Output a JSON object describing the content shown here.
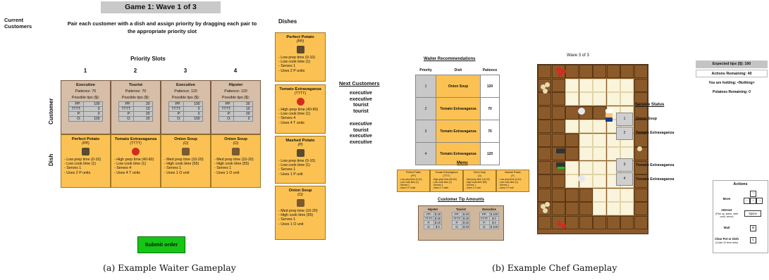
{
  "waiter": {
    "title": "Game 1:  Wave 1 of 3",
    "current_customers": "Current Customers",
    "instructions": "Pair each customer with a dish and assign priority by dragging each pair to the appropriate priority slot",
    "priority_slots_label": "Priority Slots",
    "row_labels": {
      "customer": "Customer",
      "dish": "Dish"
    },
    "slots": [
      {
        "num": "1",
        "customer": {
          "name": "Executive",
          "patience": "Patience: 70",
          "tips_label": "Possible tips ($):",
          "tips": [
            [
              "PP:",
              "100"
            ],
            [
              "TTTT:",
              "0"
            ],
            [
              "P:",
              "0"
            ],
            [
              "O:",
              "100"
            ]
          ]
        },
        "dish": {
          "name": "Perfect Potato",
          "code": "(PP)",
          "lines": [
            "-   Low prep time (0-10)",
            "-   Low cook time (1)",
            "-   Serves 1",
            "-   Uses 2 P units"
          ]
        }
      },
      {
        "num": "2",
        "customer": {
          "name": "Tourist",
          "patience": "Patience: 70",
          "tips_label": "Possible tips ($):",
          "tips": [
            [
              "PP:",
              "20"
            ],
            [
              "TTTT:",
              "10"
            ],
            [
              "P:",
              "20"
            ],
            [
              "O:",
              "20"
            ]
          ]
        },
        "dish": {
          "name": "Tomato Extravaganza",
          "code": "(TTTT)",
          "lines": [
            "-   High prep time (40-60)",
            "-   Low cook time (1)",
            "-   Serves 4",
            "-   Uses 4 T units"
          ]
        }
      },
      {
        "num": "3",
        "customer": {
          "name": "Executive",
          "patience": "Patience: 120",
          "tips_label": "Possible tips ($):",
          "tips": [
            [
              "PP:",
              "100"
            ],
            [
              "TTTT:",
              "0"
            ],
            [
              "P:",
              "0"
            ],
            [
              "O:",
              "100"
            ]
          ]
        },
        "dish": {
          "name": "Onion Soup",
          "code": "(O)",
          "lines": [
            "-   Med prep time (10-20)",
            "-   High cook time (55)",
            "-   Serves 1",
            "-   Uses 1 O unit"
          ]
        }
      },
      {
        "num": "4",
        "customer": {
          "name": "Hipster",
          "patience": "Patience: 120",
          "tips_label": "Possible tips ($):",
          "tips": [
            [
              "PP:",
              "20"
            ],
            [
              "TTTT:",
              "10"
            ],
            [
              "P:",
              "20"
            ],
            [
              "O:",
              "0"
            ]
          ]
        },
        "dish": {
          "name": "Onion Soup",
          "code": "(O)",
          "lines": [
            "-   Med prep time (10-20)",
            "-   High cook time (55)",
            "-   Serves 1",
            "-   Uses 1 O unit"
          ]
        }
      }
    ],
    "dishes_label": "Dishes",
    "side_dishes": [
      {
        "name": "Perfect Potato",
        "code": "(PP)",
        "lines": [
          "-   Low prep time (0-10)",
          "-   Low cook time (1)",
          "-   Serves 1",
          "-   Uses 2 P units"
        ]
      },
      {
        "name": "Tomato Extravaganza",
        "code": "(TTTT)",
        "lines": [
          "-   High prep time (40-60)",
          "-   Low cook time (1)",
          "-   Serves 4",
          "-   Uses 4 T units"
        ]
      },
      {
        "name": "Mashed Potato",
        "code": "(P)",
        "lines": [
          "-   Low prep time (0-10)",
          "-   Low cook time (1)",
          "-   Serves 1",
          "-   Uses 1 P unit"
        ]
      },
      {
        "name": "Onion Soup",
        "code": "(O)",
        "lines": [
          "-   Med prep time (10-20)",
          "-   High cook time (55)",
          "-   Serves 1",
          "-   Uses 1 O unit"
        ]
      }
    ],
    "next_customers_label": "Next Customers",
    "next_customers_group1": [
      "executive",
      "executive",
      "tourist",
      "tourist"
    ],
    "next_customers_group2": [
      "executive",
      "tourist",
      "executive",
      "executive"
    ],
    "submit_label": "Submit order",
    "caption": "(a) Example Waiter Gameplay"
  },
  "chef": {
    "waiter_rec_label": "Waiter Recommendations",
    "rec_headers": [
      "Priority",
      "Dish",
      "Patience"
    ],
    "recs": [
      [
        "1",
        "Onion Soup",
        "120"
      ],
      [
        "2",
        "Tomato Extravaganza",
        "70"
      ],
      [
        "3",
        "Tomato Extravaganza",
        "70"
      ],
      [
        "4",
        "Tomato Extravaganza",
        "120"
      ]
    ],
    "menu_label": "Menu",
    "menu": [
      {
        "name": "Perfect Potato",
        "code": "(PP)",
        "lines": [
          "- Low prep time (0-10)",
          "- Low cook time (1)",
          "- Serves 1",
          "- Uses 2 P units"
        ]
      },
      {
        "name": "Tomato Extravaganza",
        "code": "(TTTT)",
        "lines": [
          "- High prep time (40-60)",
          "- Low cook time (1)",
          "- Serves 4",
          "- Uses 4 T units"
        ]
      },
      {
        "name": "Onion Soup",
        "code": "(O)",
        "lines": [
          "- Med prep time (10-20)",
          "- High cook time (55)",
          "- Serves 1",
          "- Uses 1 O unit"
        ]
      },
      {
        "name": "Mashed Potato",
        "code": "(P)",
        "lines": [
          "- Low prep time (0-10)",
          "- Low cook time (1)",
          "- Serves 1",
          "- Uses 1 P unit"
        ]
      }
    ],
    "tip_amounts_label": "Customer Tip Amounts",
    "tip_amounts": [
      {
        "name": "Hipster",
        "rows": [
          [
            "PP:",
            "$ 20"
          ],
          [
            "TTTT:",
            "$ 30"
          ],
          [
            "P:",
            "$ 20"
          ],
          [
            "O:",
            "$ 0"
          ]
        ]
      },
      {
        "name": "Tourist",
        "rows": [
          [
            "PP:",
            "$ 20"
          ],
          [
            "TTTT:",
            "$ 30"
          ],
          [
            "P:",
            "$ 20"
          ],
          [
            "O:",
            "$ 20"
          ]
        ]
      },
      {
        "name": "Executive",
        "rows": [
          [
            "PP:",
            "$ 100"
          ],
          [
            "TTTT:",
            "$ 0"
          ],
          [
            "P:",
            "$ 0"
          ],
          [
            "O:",
            "$ 100"
          ]
        ]
      }
    ],
    "wave_label": "Wave 3 of 3",
    "service_status_label": "Service Status",
    "service_status": [
      {
        "num": "1",
        "dish": "Onion Soup"
      },
      {
        "num": "2",
        "dish": "Tomato Extravaganza"
      },
      {
        "num": "3",
        "dish": "Tomato Extravaganza"
      },
      {
        "num": "4",
        "dish": "Tomato Extravaganza"
      }
    ],
    "expected_tips": "Expected tips ($): 160",
    "actions_remaining": "Actions Remaining: 40",
    "holding": "You are holding: <Nothing>",
    "potatoes_remaining": "Potatoes Remaining: 0",
    "actions_label": "Actions",
    "actions": [
      {
        "label": "Move",
        "keys": [
          "↑",
          "←",
          "↓",
          "→"
        ]
      },
      {
        "label": "Interact",
        "sub": "(Pick up, place, start cook, serve)",
        "key": "Space"
      },
      {
        "label": "Wait",
        "key": "w"
      },
      {
        "label": "Clear Pot or Dish",
        "sub": "(Costs 10 time units)",
        "key": "c"
      }
    ],
    "caption": "(b) Example Chef Gameplay"
  },
  "colors": {
    "dish_card": "#fbc253",
    "customer_card": "#d6bea8",
    "submit": "#15c615",
    "counter": "#8b5a2b",
    "floor": "#fbf4dc"
  }
}
